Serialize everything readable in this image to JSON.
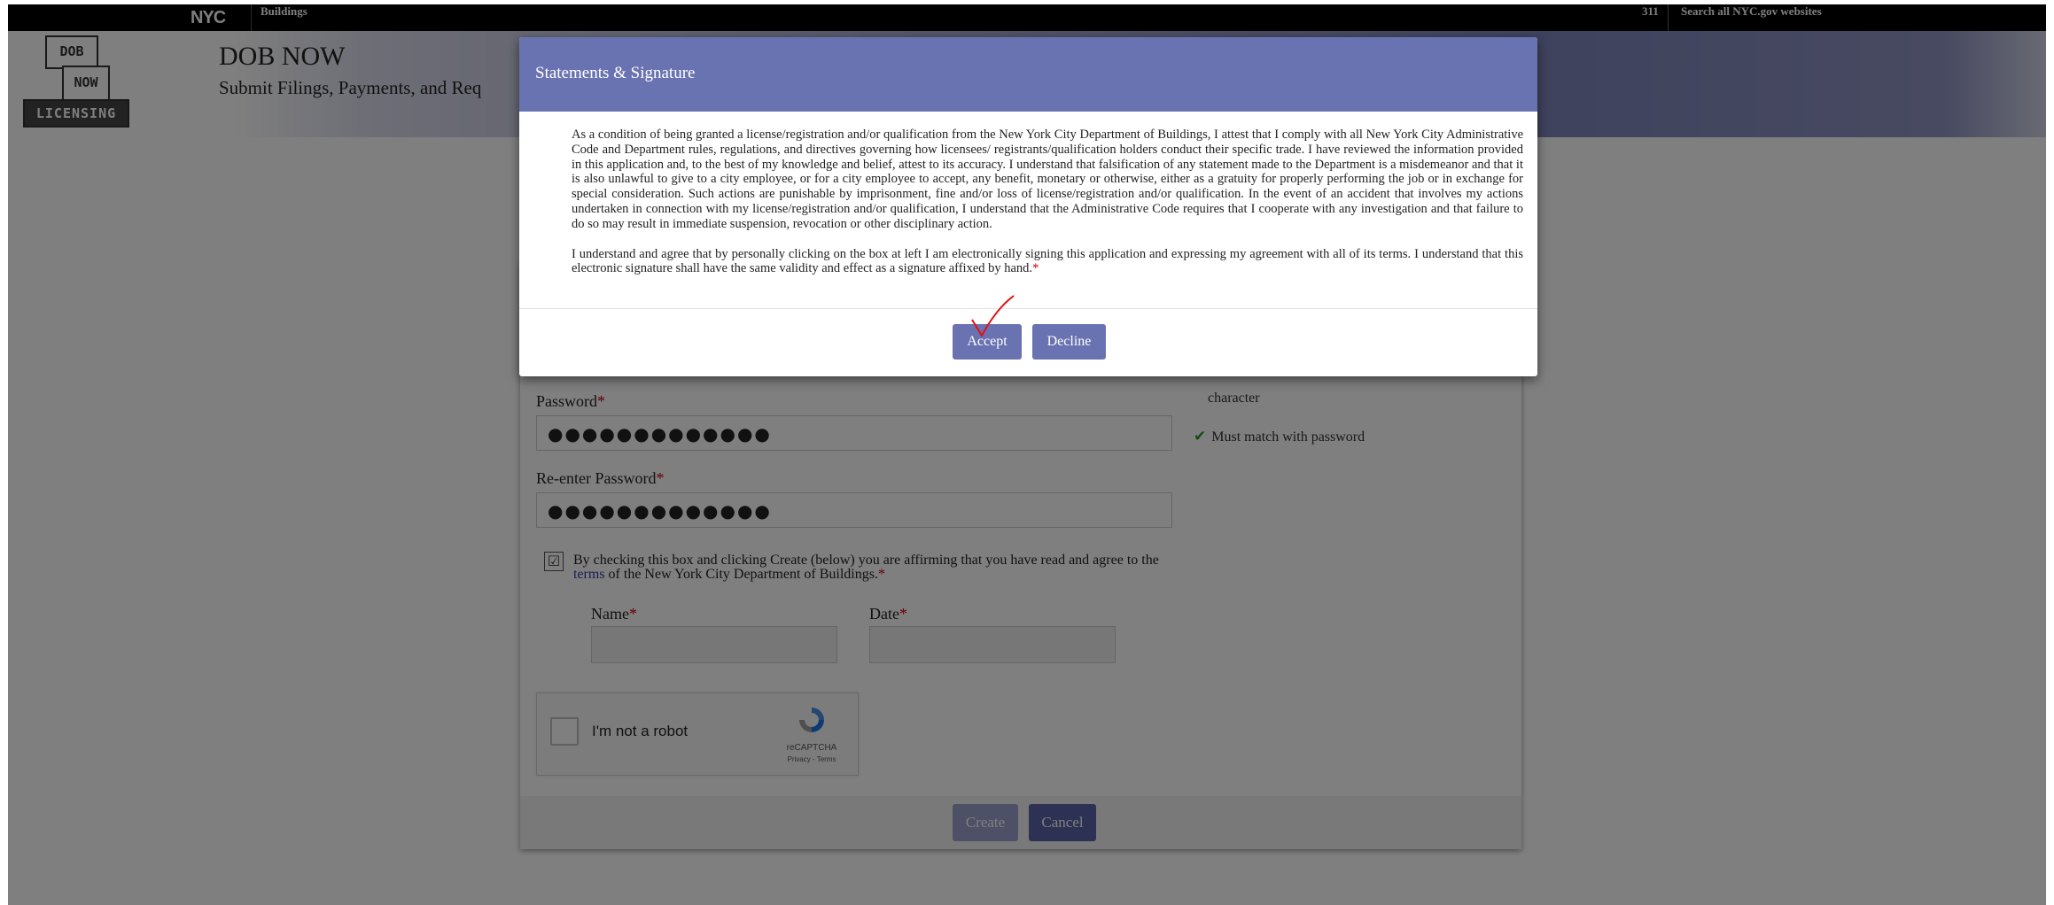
{
  "topbar": {
    "logo": "NYC",
    "agency": "Buildings",
    "link_311": "311",
    "search_link": "Search all NYC.gov websites"
  },
  "header": {
    "logo_top": "DOB",
    "logo_mid": "NOW",
    "logo_bottom": "LICENSING",
    "title": "DOB NOW",
    "subtitle": "Submit Filings, Payments, and Req"
  },
  "form": {
    "password_label": "Password",
    "password_value": "●●●●●●●●●●●●●",
    "reenter_label": "Re-enter Password",
    "reenter_value": "●●●●●●●●●●●●●",
    "hint_character": "character",
    "hint_match": "Must match with password",
    "affirm_text_before": "By checking this box and clicking Create (below) you are affirming that you have read and agree to the ",
    "affirm_link": "terms",
    "affirm_text_after": " of the New York City Department of Buildings.",
    "name_label": "Name",
    "date_label": "Date",
    "required_mark": "*",
    "create_label": "Create",
    "cancel_label": "Cancel"
  },
  "recaptcha": {
    "label": "I'm not a robot",
    "brand": "reCAPTCHA",
    "links": "Privacy - Terms"
  },
  "modal": {
    "title": "Statements & Signature",
    "paragraph1": "As a condition of being granted a license/registration and/or qualification from the New York City Department of Buildings, I attest that I comply with all New York City Administrative Code and Department rules, regulations, and directives governing how licensees/ registrants/qualification holders conduct their specific trade. I have reviewed the information provided in this application and, to the best of my knowledge and belief, attest to its accuracy. I understand that falsification of any statement made to the Department is a misdemeanor and that it is also unlawful to give to a city employee, or for a city employee to accept, any benefit, monetary or otherwise, either as a gratuity for properly performing the job or in exchange for special consideration. Such actions are punishable by imprisonment, fine and/or loss of license/registration and/or qualification. In the event of an accident that involves my actions undertaken in connection with my license/registration and/or qualification, I understand that the Administrative Code requires that I cooperate with any investigation and that failure to do so may result in immediate suspension, revocation or other disciplinary action.",
    "paragraph2": "I understand and agree that by personally clicking on the box at left I am electronically signing this application and expressing my agreement with all of its terms. I understand that this electronic signature shall have the same validity and effect as a signature affixed by hand.",
    "required_mark": "*",
    "accept_label": "Accept",
    "decline_label": "Decline"
  },
  "colors": {
    "modal_header": "#6a73b1",
    "button_primary": "#6a73b1",
    "button_cancel": "#5b62a8",
    "required": "#cc0000",
    "check": "#2a9a2a",
    "link": "#2a3aa0"
  }
}
